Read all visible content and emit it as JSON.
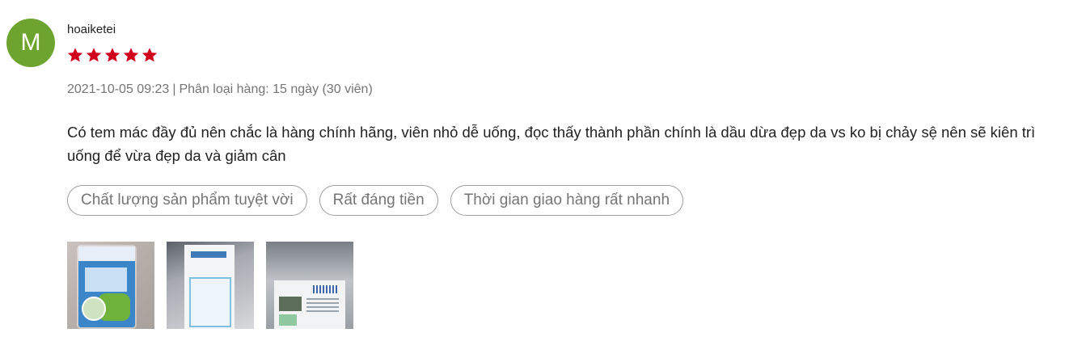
{
  "review": {
    "avatar_letter": "M",
    "avatar_color": "#6ca42f",
    "username": "hoaiketei",
    "rating": 5,
    "rating_max": 5,
    "star_color": "#d0011b",
    "date": "2021-10-05 09:23",
    "separator": "|",
    "variant_label": "Phân loại hàng:",
    "variant_value": "15 ngày (30 viên)",
    "content": "Có tem mác đầy đủ nên chắc là hàng chính hãng, viên nhỏ dễ uống, đọc thấy thành phần chính là dầu dừa đẹp da vs ko bị chảy sệ nên sẽ kiên trì uống để vừa đẹp da và giảm cân",
    "tags": [
      "Chất lượng sản phẩm tuyệt vời",
      "Rất đáng tiền",
      "Thời gian giao hàng rất nhanh"
    ],
    "photos": [
      {
        "name": "review-photo-1"
      },
      {
        "name": "review-photo-2"
      },
      {
        "name": "review-photo-3"
      }
    ]
  }
}
